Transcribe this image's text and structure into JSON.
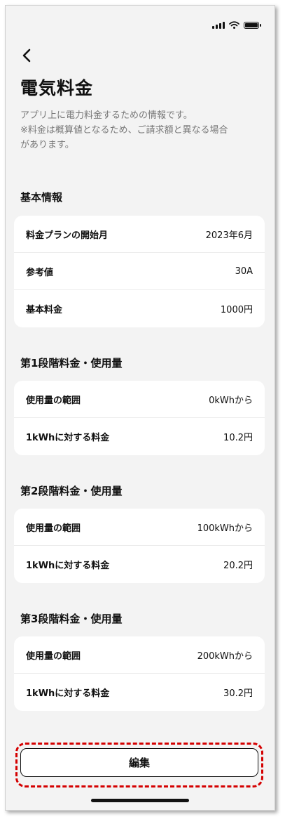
{
  "page": {
    "title": "電気料金",
    "description_line1": "アプリ上に電力料金するための情報です。",
    "description_line2": "※料金は概算値となるため、ご請求額と異なる場合",
    "description_line3": "があります。"
  },
  "icons": {
    "back": "chevron-left-icon",
    "signal": "cellular-signal-icon",
    "wifi": "wifi-icon",
    "battery": "battery-icon"
  },
  "sections": [
    {
      "title": "基本情報",
      "rows": [
        {
          "label": "料金プランの開始月",
          "value": "2023年6月"
        },
        {
          "label": "参考値",
          "value": "30A"
        },
        {
          "label": "基本料金",
          "value": "1000円"
        }
      ]
    },
    {
      "title": "第1段階料金・使用量",
      "rows": [
        {
          "label": "使用量の範囲",
          "value": "0kWhから"
        },
        {
          "label": "1kWhに対する料金",
          "value": "10.2円"
        }
      ]
    },
    {
      "title": "第2段階料金・使用量",
      "rows": [
        {
          "label": "使用量の範囲",
          "value": "100kWhから"
        },
        {
          "label": "1kWhに対する料金",
          "value": "20.2円"
        }
      ]
    },
    {
      "title": "第3段階料金・使用量",
      "rows": [
        {
          "label": "使用量の範囲",
          "value": "200kWhから"
        },
        {
          "label": "1kWhに対する料金",
          "value": "30.2円"
        }
      ]
    }
  ],
  "actions": {
    "edit_label": "編集"
  },
  "colors": {
    "highlight": "#d40000",
    "background": "#f3f3f3",
    "card": "#ffffff"
  }
}
